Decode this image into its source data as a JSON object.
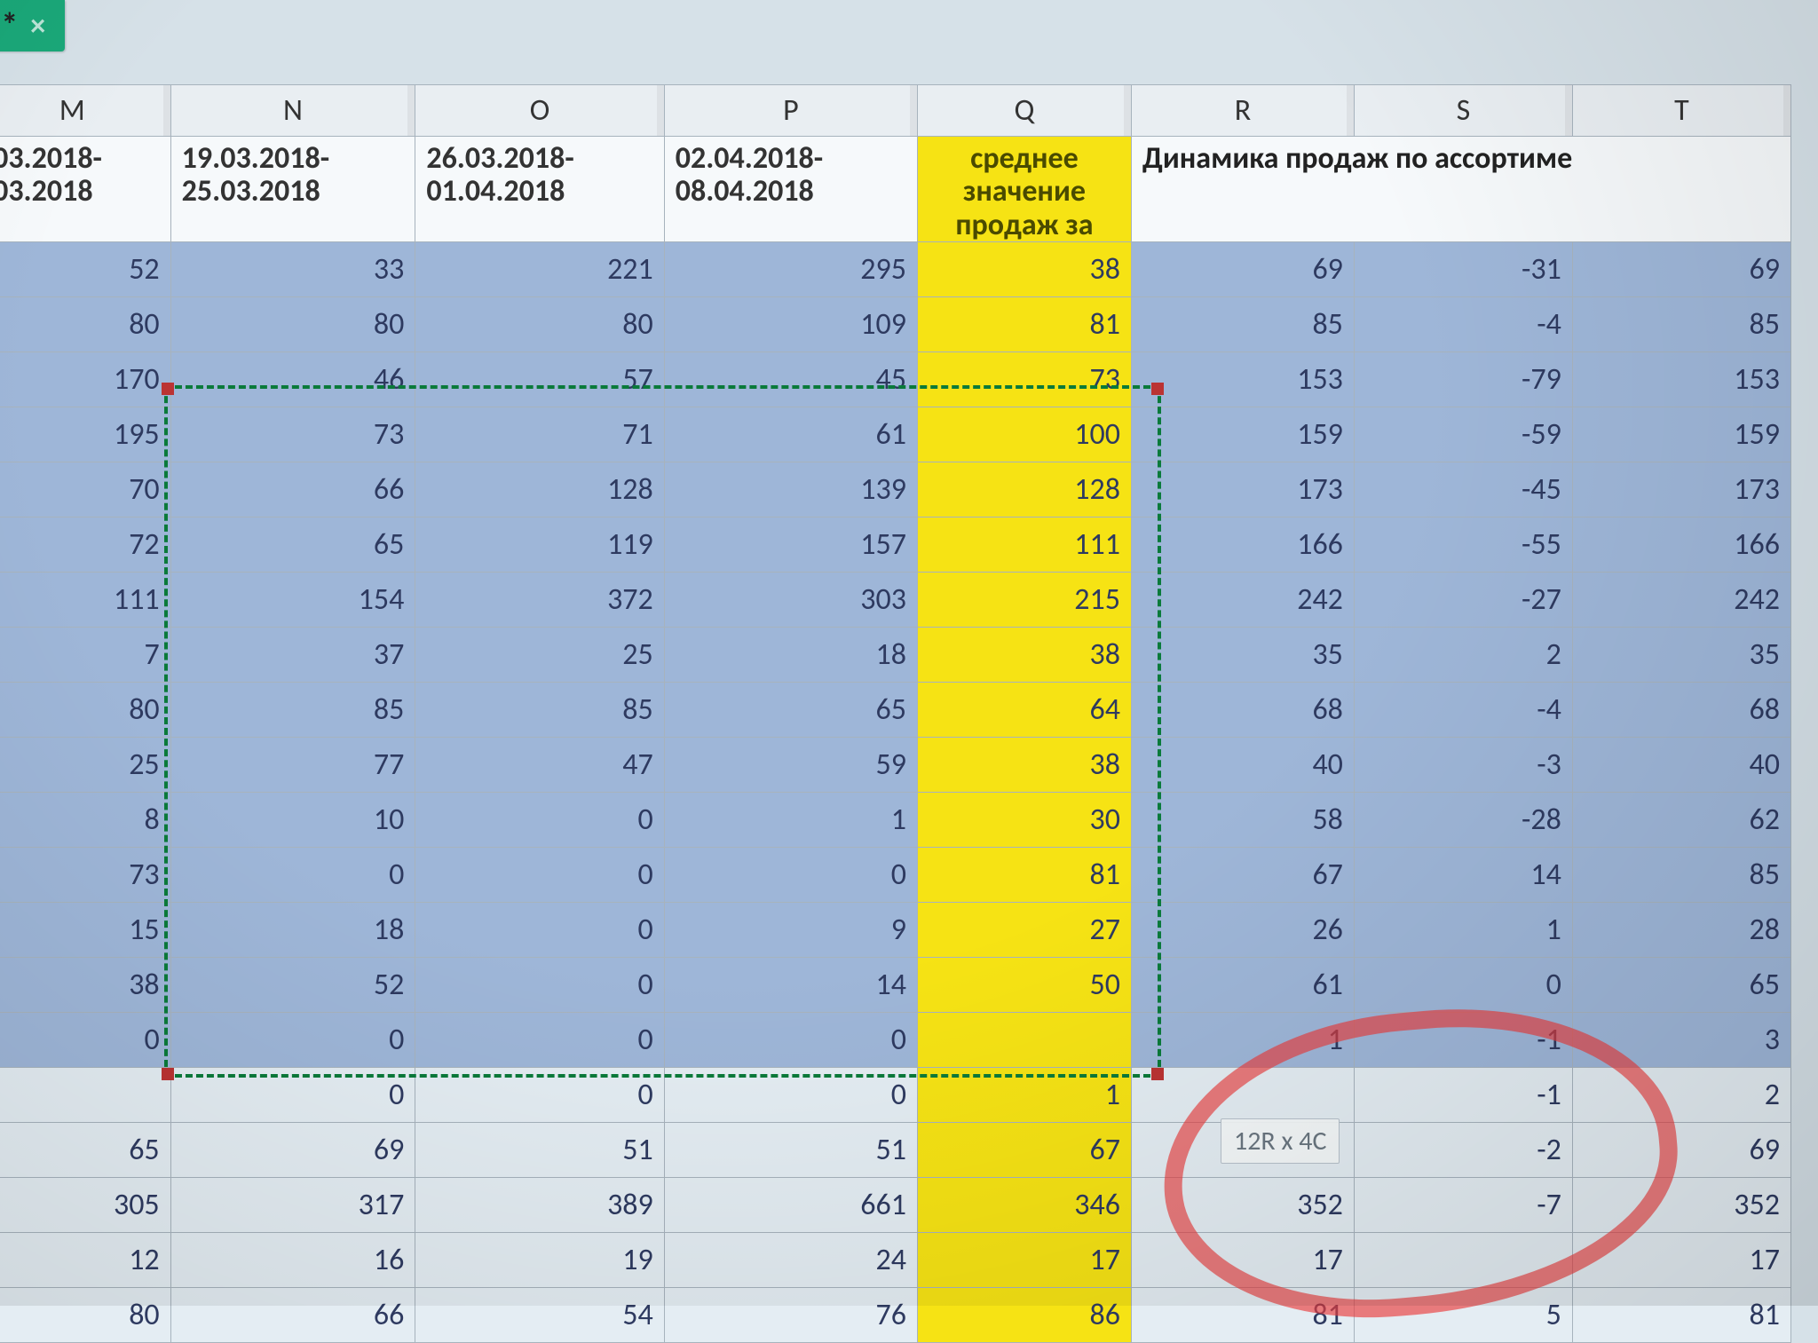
{
  "tab": {
    "title": "И *",
    "close": "×"
  },
  "columns": [
    "M",
    "N",
    "O",
    "P",
    "Q",
    "R",
    "S",
    "T"
  ],
  "headers": {
    "M": ".03.2018-\n.03.2018",
    "N": "19.03.2018-\n25.03.2018",
    "O": "26.03.2018-\n01.04.2018",
    "P": "02.04.2018-\n08.04.2018",
    "Q": "среднее\nзначение\nпродаж за",
    "RST": "Динамика продаж по ассортиме"
  },
  "rows": [
    {
      "sel": true,
      "M": 52,
      "N": 33,
      "O": 221,
      "P": 295,
      "Q": 38,
      "R": 69,
      "S": -31,
      "T": 69
    },
    {
      "sel": true,
      "M": 80,
      "N": 80,
      "O": 80,
      "P": 109,
      "Q": 81,
      "R": 85,
      "S": -4,
      "T": 85
    },
    {
      "sel": true,
      "M": 170,
      "N": 46,
      "O": 57,
      "P": 45,
      "Q": 73,
      "R": 153,
      "S": -79,
      "T": 153
    },
    {
      "sel": true,
      "M": 195,
      "N": 73,
      "O": 71,
      "P": 61,
      "Q": 100,
      "R": 159,
      "S": -59,
      "T": 159
    },
    {
      "sel": true,
      "M": 70,
      "N": 66,
      "O": 128,
      "P": 139,
      "Q": 128,
      "R": 173,
      "S": -45,
      "T": 173
    },
    {
      "sel": true,
      "M": 72,
      "N": 65,
      "O": 119,
      "P": 157,
      "Q": 111,
      "R": 166,
      "S": -55,
      "T": 166
    },
    {
      "sel": true,
      "M": 111,
      "N": 154,
      "O": 372,
      "P": 303,
      "Q": 215,
      "R": 242,
      "S": -27,
      "T": 242
    },
    {
      "sel": true,
      "M": 7,
      "N": 37,
      "O": 25,
      "P": 18,
      "Q": 38,
      "R": 35,
      "S": 2,
      "T": 35
    },
    {
      "sel": true,
      "M": 80,
      "N": 85,
      "O": 85,
      "P": 65,
      "Q": 64,
      "R": 68,
      "S": -4,
      "T": 68
    },
    {
      "sel": true,
      "M": 25,
      "N": 77,
      "O": 47,
      "P": 59,
      "Q": 38,
      "R": 40,
      "S": -3,
      "T": 40
    },
    {
      "sel": true,
      "M": 8,
      "N": 10,
      "O": 0,
      "P": 1,
      "Q": 30,
      "R": 58,
      "S": -28,
      "T": 62
    },
    {
      "sel": true,
      "M": 73,
      "N": 0,
      "O": 0,
      "P": 0,
      "Q": 81,
      "R": 67,
      "S": 14,
      "T": 85
    },
    {
      "sel": true,
      "M": 15,
      "N": 18,
      "O": 0,
      "P": 9,
      "Q": 27,
      "R": 26,
      "S": 1,
      "T": 28
    },
    {
      "sel": true,
      "M": 38,
      "N": 52,
      "O": 0,
      "P": 14,
      "Q": 50,
      "R": 61,
      "S": 0,
      "T": 65
    },
    {
      "sel": true,
      "M": 0,
      "N": 0,
      "O": 0,
      "P": 0,
      "Q": "",
      "R": 1,
      "S": -1,
      "T": 3
    },
    {
      "sel": false,
      "M": "",
      "N": 0,
      "O": 0,
      "P": 0,
      "Q": 1,
      "R": "",
      "S": -1,
      "T": 2
    },
    {
      "sel": false,
      "M": 65,
      "N": 69,
      "O": 51,
      "P": 51,
      "Q": 67,
      "R": "",
      "S": -2,
      "T": 69
    },
    {
      "sel": false,
      "M": 305,
      "N": 317,
      "O": 389,
      "P": 661,
      "Q": 346,
      "R": 352,
      "S": -7,
      "T": 352
    },
    {
      "sel": false,
      "M": 12,
      "N": 16,
      "O": 19,
      "P": 24,
      "Q": 17,
      "R": 17,
      "S": "",
      "T": 17
    },
    {
      "sel": false,
      "M": 80,
      "N": 66,
      "O": 54,
      "P": 76,
      "Q": 86,
      "R": 81,
      "S": 5,
      "T": 81
    }
  ],
  "tooltip": "12R x 4C"
}
